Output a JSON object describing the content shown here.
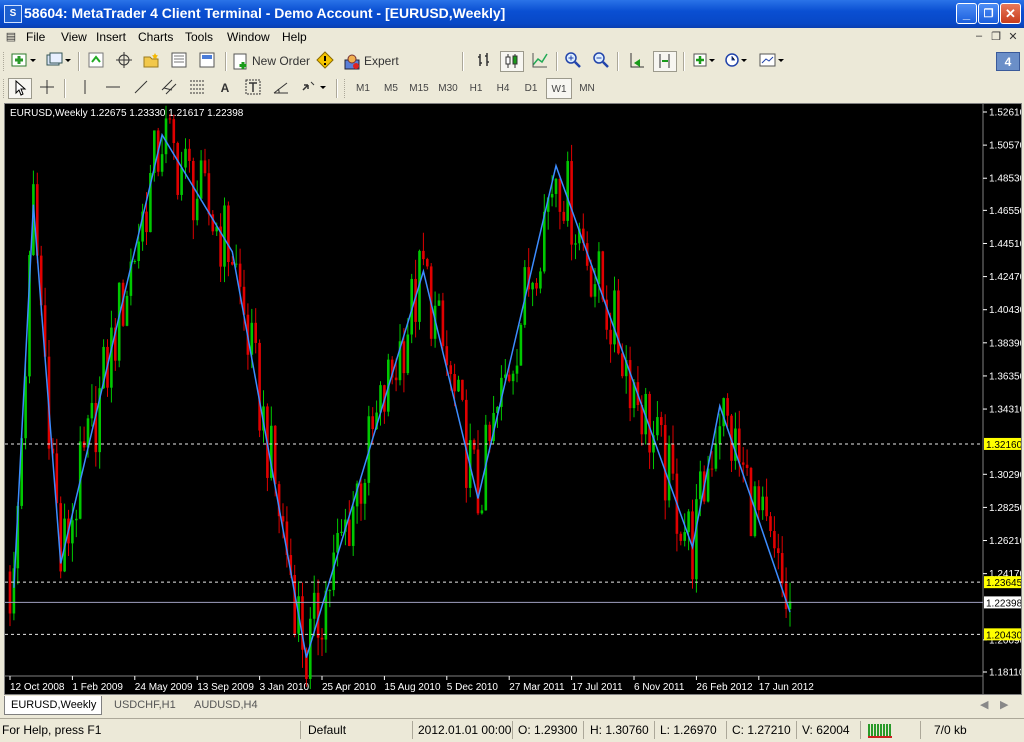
{
  "window": {
    "title": "58604: MetaTrader 4 Client Terminal - Demo Account - [EURUSD,Weekly]",
    "app_icon": "S",
    "controls": {
      "minimize": "_",
      "maximize": "❐",
      "close": "✕"
    }
  },
  "menu": {
    "items": [
      "File",
      "View",
      "Insert",
      "Charts",
      "Tools",
      "Window",
      "Help"
    ]
  },
  "toolbar": {
    "new_order": "New Order",
    "expert_advisors": "Expert Advisors",
    "badge": "4",
    "timeframes": [
      "M1",
      "M5",
      "M15",
      "M30",
      "H1",
      "H4",
      "D1",
      "W1",
      "MN"
    ],
    "active_timeframe": "W1",
    "draw_tools": [
      "A"
    ]
  },
  "chart": {
    "symbol_info": "EURUSD,Weekly  1.22675 1.23330 1.21617 1.22398",
    "colors": {
      "background": "#000000",
      "bull": "#00c800",
      "bear": "#e00000",
      "zigzag": "#3c8cff",
      "level_line": "#ffffff",
      "price_tag": "#ffff00",
      "axis_text": "#ffffff"
    }
  },
  "chart_data": {
    "type": "candlestick",
    "symbol": "EURUSD",
    "timeframe": "Weekly",
    "ohlc_last": {
      "open": 1.22675,
      "high": 1.2333,
      "low": 1.21617,
      "close": 1.22398
    },
    "y_ticks": [
      "1.52610",
      "1.50570",
      "1.48530",
      "1.46550",
      "1.44510",
      "1.42470",
      "1.40430",
      "1.38390",
      "1.36350",
      "1.34310",
      "1.30290",
      "1.28250",
      "1.26210",
      "1.24170",
      "1.20090",
      "1.18110"
    ],
    "ylim": [
      1.1811,
      1.5261
    ],
    "x_ticks": [
      "12 Oct 2008",
      "1 Feb 2009",
      "24 May 2009",
      "13 Sep 2009",
      "3 Jan 2010",
      "25 Apr 2010",
      "15 Aug 2010",
      "5 Dec 2010",
      "27 Mar 2011",
      "17 Jul 2011",
      "6 Nov 2011",
      "26 Feb 2012",
      "17 Jun 2012"
    ],
    "x_tick_index": [
      0,
      16,
      32,
      48,
      64,
      80,
      96,
      112,
      128,
      144,
      160,
      176,
      192
    ],
    "horizontal_levels": [
      {
        "price": 1.3216,
        "label": "1.32160",
        "style": "dashed",
        "tag": "yellow"
      },
      {
        "price": 1.23645,
        "label": "1.23645",
        "style": "dashed",
        "tag": "yellow"
      },
      {
        "price": 1.22398,
        "label": "1.22398",
        "style": "solid",
        "tag": "white"
      },
      {
        "price": 1.2043,
        "label": "1.20430",
        "style": "dashed",
        "tag": "yellow"
      }
    ],
    "zigzag": [
      {
        "i": 1,
        "price": 1.233
      },
      {
        "i": 6,
        "price": 1.469
      },
      {
        "i": 13,
        "price": 1.248
      },
      {
        "i": 39,
        "price": 1.512
      },
      {
        "i": 57,
        "price": 1.44
      },
      {
        "i": 76,
        "price": 1.19
      },
      {
        "i": 106,
        "price": 1.428
      },
      {
        "i": 120,
        "price": 1.288
      },
      {
        "i": 140,
        "price": 1.493
      },
      {
        "i": 175,
        "price": 1.258
      },
      {
        "i": 182,
        "price": 1.345
      },
      {
        "i": 200,
        "price": 1.218
      }
    ]
  },
  "tabs": [
    "EURUSD,Weekly",
    "USDCHF,H1",
    "AUDUSD,H4"
  ],
  "active_tab": 0,
  "status": {
    "help": "For Help, press F1",
    "profile": "Default",
    "datetime": "2012.01.01 00:00",
    "open": "O: 1.29300",
    "high": "H: 1.30760",
    "low": "L: 1.26970",
    "close": "C: 1.27210",
    "volume": "V: 62004",
    "traffic": "7/0 kb"
  }
}
